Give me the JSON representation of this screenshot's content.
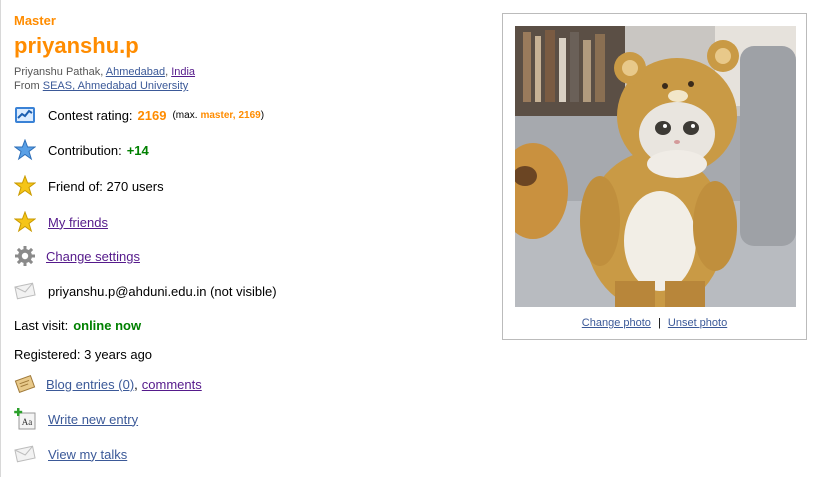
{
  "colors": {
    "rank_master": "#ff8c00",
    "online": "#008000",
    "link": "#3b5998",
    "visited_link": "#551a8b"
  },
  "profile": {
    "rank": "Master",
    "handle": "priyanshu.p",
    "full_name": "Priyanshu Pathak",
    "city": "Ahmedabad",
    "country": "India",
    "from_label": "From",
    "organization": "SEAS, Ahmedabad University"
  },
  "info": {
    "rating_label": "Contest rating:",
    "rating_value": "2169",
    "rating_max_prefix": "(max.",
    "rating_max_rank": "master,",
    "rating_max_value": "2169",
    "rating_max_suffix": ")",
    "contribution_label": "Contribution:",
    "contribution_value": "+14",
    "friend_of": "Friend of: 270 users",
    "my_friends": "My friends",
    "change_settings": "Change settings",
    "email": "priyanshu.p@ahduni.edu.in (not visible)",
    "last_visit_label": "Last visit:",
    "last_visit_value": "online now",
    "registered": "Registered: 3 years ago",
    "blog_entries": "Blog entries (0)",
    "comma": ",",
    "comments": "comments",
    "write_new_entry": "Write new entry",
    "view_my_talks": "View my talks"
  },
  "photo": {
    "change": "Change photo",
    "separator": "|",
    "unset": "Unset photo"
  },
  "icons": {
    "rating": "rating-chart-icon",
    "contribution": "blue-star-icon",
    "friend_of": "gold-star-icon",
    "my_friends": "gold-star-icon",
    "settings": "gear-icon",
    "email": "envelope-icon",
    "blog": "blog-icon",
    "write": "write-entry-icon",
    "talks": "envelope-icon"
  }
}
